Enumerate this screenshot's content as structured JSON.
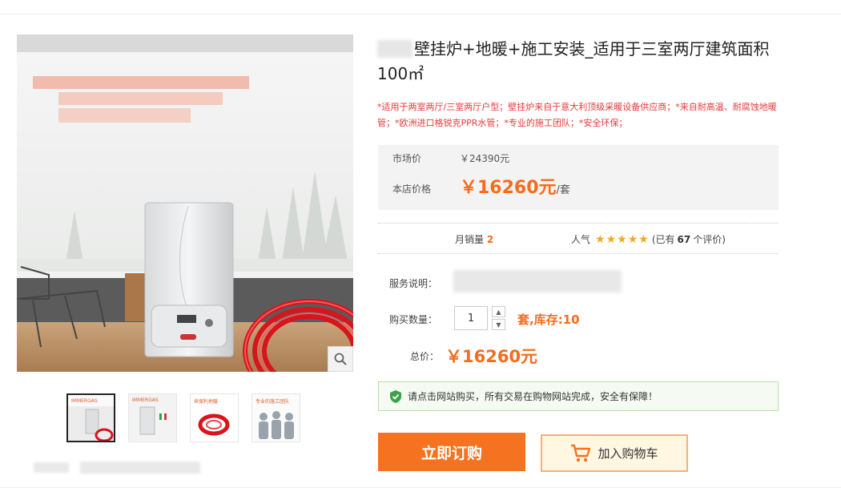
{
  "product": {
    "title": "壁挂炉+地暖+施工安装_适用于三室两厅建筑面积100㎡",
    "promo": "*适用于两室两厅/三室两厅户型；壁挂炉来自于意大利顶级采暖设备供应商；*来自耐高温、耐腐蚀地暖管；*欧洲进口格锐克PPR水管；*专业的施工团队；*安全环保；"
  },
  "price": {
    "market_label": "市场价",
    "market_value": "￥24390元",
    "shop_label": "本店价格",
    "shop_value": "￥16260元",
    "shop_unit": "/套"
  },
  "stats": {
    "sales_label": "月销量",
    "sales_value": "2",
    "pop_label": "人气",
    "rating": 5,
    "review_prefix": "(已有",
    "review_count": "67",
    "review_suffix": "个评价)"
  },
  "service": {
    "label": "服务说明："
  },
  "quantity": {
    "label": "购买数量：",
    "value": "1",
    "stock": "套,库存:10"
  },
  "total": {
    "label": "总价：",
    "value": "￥16260元"
  },
  "notice": {
    "text": "请点击网站购买，所有交易在购物网站完成，安全有保障！"
  },
  "actions": {
    "buy_label": "立即订购",
    "cart_label": "加入购物车"
  },
  "gallery": {
    "thumbs": [
      {
        "caption": "IMMERGAS"
      },
      {
        "caption": "IMMERGAS"
      },
      {
        "caption": "来保利地暖"
      },
      {
        "caption": "专业的施工团队"
      }
    ]
  },
  "icons": {
    "zoom": "magnifier-icon",
    "shield": "shield-check-icon",
    "cart": "cart-icon",
    "star": "star-icon"
  },
  "colors": {
    "accent": "#f56c1d",
    "buy": "#f57320",
    "promo": "#e4393c",
    "notice_border": "#b7dfa8",
    "star": "#f5a623"
  }
}
